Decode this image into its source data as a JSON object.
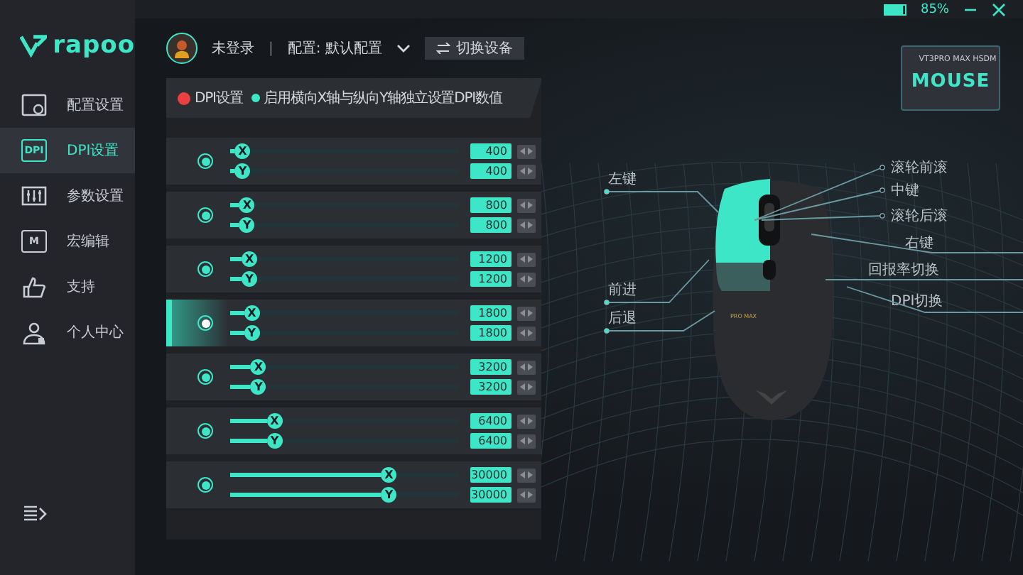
{
  "sidebar": {
    "logo": "rapoo",
    "items": [
      {
        "label": "配置设置",
        "selected": false
      },
      {
        "label": "DPI设置",
        "icon_text": "DPI",
        "selected": true
      },
      {
        "label": "参数设置",
        "selected": false
      },
      {
        "label": "宏编辑",
        "icon_text": "M",
        "selected": false
      },
      {
        "label": "支持",
        "selected": false
      },
      {
        "label": "个人中心",
        "selected": false
      }
    ]
  },
  "status": {
    "battery": "85%",
    "level": 0.85
  },
  "header": {
    "user": "未登录",
    "separator": "|",
    "profile": "配置: 默认配置",
    "switch_button": "切换设备"
  },
  "device": {
    "model": "VT3PRO MAX HSDM",
    "type": "MOUSE"
  },
  "panel": {
    "options": [
      {
        "label": "DPI设置",
        "color": "#e8413f"
      },
      {
        "label": "启用横向X轴与纵向Y轴独立设置DPI数值",
        "color": "#3ee6c8"
      }
    ],
    "rows": [
      {
        "selected": false,
        "axes": [
          {
            "label": "X",
            "value": "400",
            "level": 0.02
          },
          {
            "label": "Y",
            "value": "400",
            "level": 0.02
          }
        ]
      },
      {
        "selected": false,
        "axes": [
          {
            "label": "X",
            "value": "800",
            "level": 0.04
          },
          {
            "label": "Y",
            "value": "800",
            "level": 0.04
          }
        ]
      },
      {
        "selected": false,
        "axes": [
          {
            "label": "X",
            "value": "1200",
            "level": 0.05
          },
          {
            "label": "Y",
            "value": "1200",
            "level": 0.05
          }
        ]
      },
      {
        "selected": true,
        "axes": [
          {
            "label": "X",
            "value": "1800",
            "level": 0.06
          },
          {
            "label": "Y",
            "value": "1800",
            "level": 0.06
          }
        ]
      },
      {
        "selected": false,
        "axes": [
          {
            "label": "X",
            "value": "3200",
            "level": 0.09
          },
          {
            "label": "Y",
            "value": "3200",
            "level": 0.09
          }
        ]
      },
      {
        "selected": false,
        "axes": [
          {
            "label": "X",
            "value": "6400",
            "level": 0.16
          },
          {
            "label": "Y",
            "value": "6400",
            "level": 0.16
          }
        ]
      },
      {
        "selected": false,
        "axes": [
          {
            "label": "X",
            "value": "30000",
            "level": 0.66
          },
          {
            "label": "Y",
            "value": "30000",
            "level": 0.66
          }
        ]
      }
    ]
  },
  "mouse": {
    "print": "PRO MAX",
    "labels": [
      {
        "text": "左键"
      },
      {
        "text": "前进"
      },
      {
        "text": "后退"
      },
      {
        "text": "滚轮前滚"
      },
      {
        "text": "中键"
      },
      {
        "text": "滚轮后滚"
      },
      {
        "text": "右键"
      },
      {
        "text": "回报率切换"
      },
      {
        "text": "DPI切换"
      }
    ]
  }
}
